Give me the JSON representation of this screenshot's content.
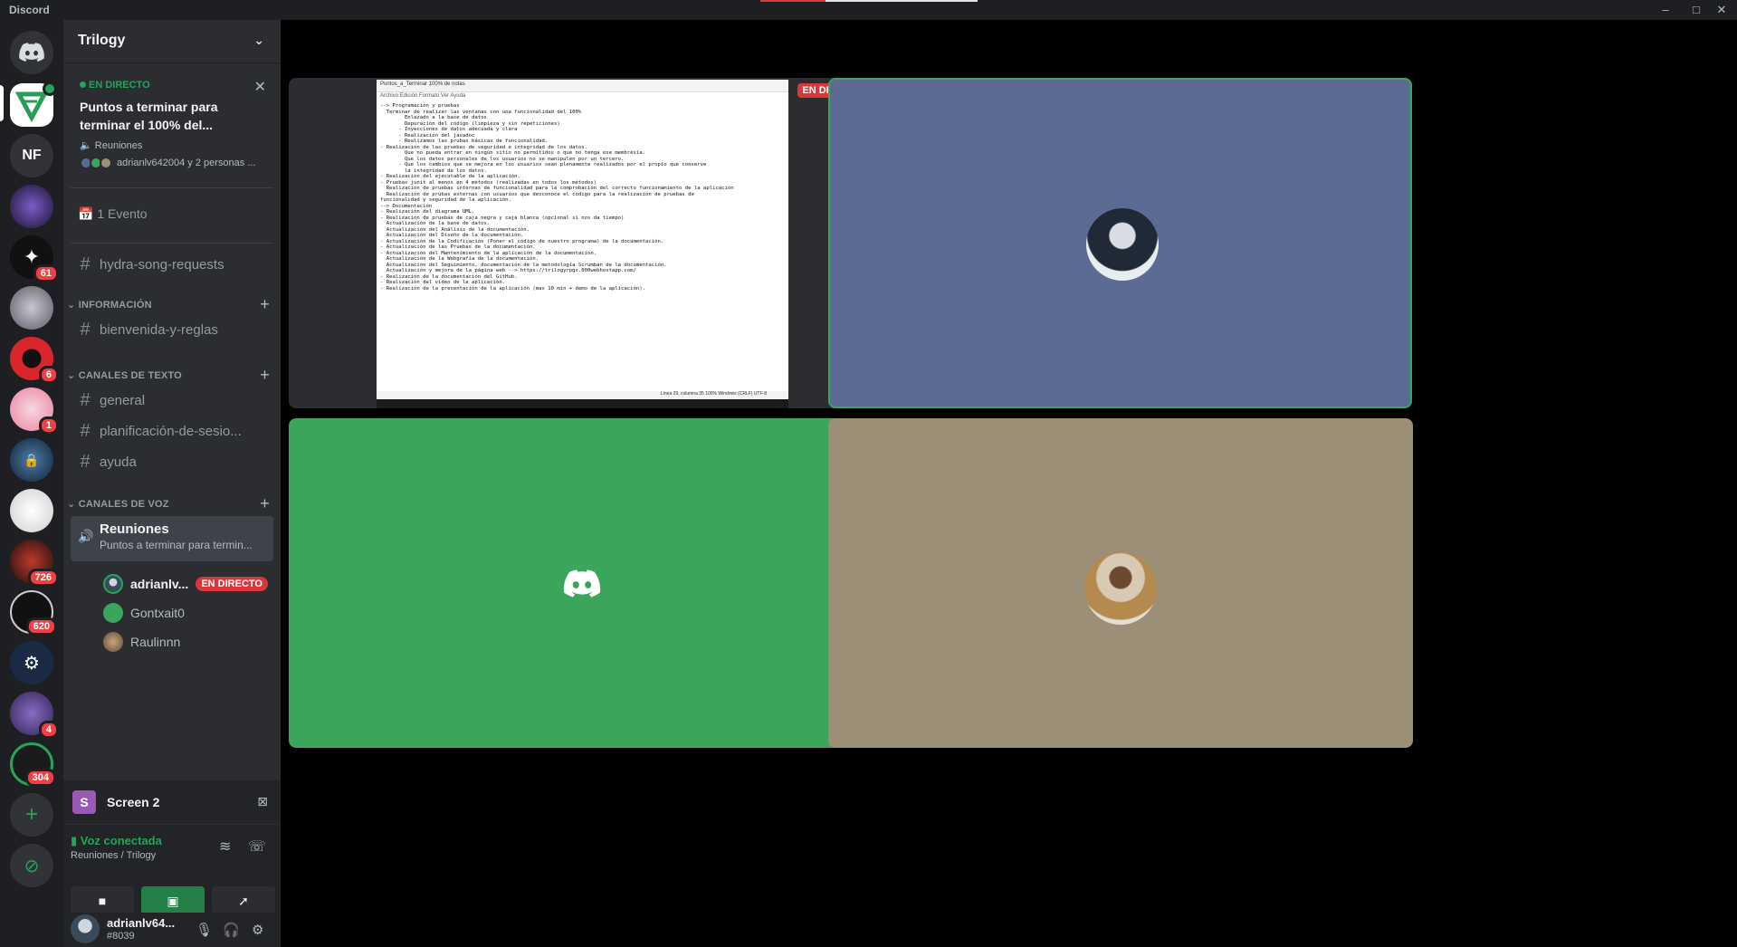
{
  "window": {
    "app_name": "Discord",
    "progress": 0.3,
    "controls": [
      "–",
      "□",
      "✕"
    ]
  },
  "rail": {
    "servers": [
      {
        "name": "Home",
        "label": ""
      },
      {
        "name": "Trilogy",
        "label": ""
      },
      {
        "name": "NF",
        "label": "NF"
      },
      {
        "name": "server-4",
        "label": ""
      },
      {
        "name": "server-5",
        "label": "",
        "badge": "61"
      },
      {
        "name": "server-6",
        "label": ""
      },
      {
        "name": "server-7",
        "label": "",
        "badge": "6"
      },
      {
        "name": "server-8",
        "label": "",
        "badge": "1"
      },
      {
        "name": "server-9",
        "label": ""
      },
      {
        "name": "server-10",
        "label": ""
      },
      {
        "name": "server-11",
        "label": "",
        "badge": "726"
      },
      {
        "name": "server-12",
        "label": "",
        "badge": "620"
      },
      {
        "name": "server-13",
        "label": ""
      },
      {
        "name": "server-14",
        "label": "",
        "badge": "4"
      },
      {
        "name": "server-15",
        "label": "",
        "badge": "304"
      }
    ],
    "add_label": "+",
    "explore_label": "⊘"
  },
  "sidebar": {
    "guild_name": "Trilogy",
    "event": {
      "live_label": "EN DIRECTO",
      "title": "Puntos a terminar para terminar el 100% del...",
      "channel": "Reuniones",
      "users": "adrianlv642004 y 2 personas ..."
    },
    "events_count": "1 Evento",
    "channels_top": [
      {
        "name": "hydra-song-requests"
      }
    ],
    "categories": {
      "info": "INFORMACIÓN",
      "text": "CANALES DE TEXTO",
      "voice": "CANALES DE VOZ"
    },
    "info_channels": [
      {
        "name": "bienvenida-y-reglas"
      }
    ],
    "text_channels": [
      {
        "name": "general"
      },
      {
        "name": "planificación-de-sesio..."
      },
      {
        "name": "ayuda"
      }
    ],
    "voice_channel": {
      "name": "Reuniones",
      "subtitle": "Puntos a terminar para termin...",
      "users": [
        {
          "name": "adrianlv...",
          "live": "EN DIRECTO"
        },
        {
          "name": "Gontxait0"
        },
        {
          "name": "Raulinnn"
        }
      ]
    },
    "screen_panel": {
      "icon_letter": "S",
      "label": "Screen 2"
    },
    "voice_panel": {
      "status": "Voz conectada",
      "location": "Reuniones / Trilogy"
    },
    "user_panel": {
      "name": "adrianlv64...",
      "tag": "#8039"
    }
  },
  "stage": {
    "live_badge": "EN DIRECTO",
    "more_label": "•••",
    "document": {
      "title": "Puntos_a_Terminar 100% de notas",
      "menu": "Archivo   Edición   Formato   Ver   Ayuda",
      "lines": [
        "--> Programación y pruebas",
        "  Terminar de realizar las ventanas con una funcionalidad del 100%",
        "        Enlazado a la base de datos",
        "        Depuración del código (limpieza y sin repeticiones)",
        "      - Inyecciones de datos adecuada y clara",
        "      - Realización del javadoc",
        "      - Realizamos las prubas básicas de funcionalidad.",
        "- Realización de las pruebas de seguridad e integridad de los datos.",
        "        Que no pueda entrar en ningún sitio no permitidos o que no tenga ese membresía.",
        "        Que los datos personales de los usuarios no se manipulen por un tercero.",
        "      - Que los cambios que se mejora en los usuarios sean plenamente realizados por el propio que conserve",
        "        la integridad de los datos.",
        "- Realización del ejecutable de la aplicación.",
        "- Pruebas junit al menos en 4 métodos (realizadas en todos los métodos)",
        "  Realización de pruebas internas de funcionalidad para la comprobación del correcto funcionamiento de la aplicación",
        "  Realización de prubas externas con usuarios que desconoce el código para la realización de pruebas de",
        "funcionalidad y seguridad de la aplicación.",
        "--> Documentación",
        "- Realización del diagrama UML.",
        "- Realización de pruebas de caja negra y caja blanca (opcional si nos da tiempo)",
        "  Actualización de la base de datos.",
        "  Actualización del Análisis de la documentación.",
        "  Actualización del Diseño de la documentación.",
        "- Actualización de la Codificación (Poner el código de nuestro programa) de la documentación.",
        "- Actualización de las Pruebas de la documentación.",
        "- Actualización del Mantenimiento de la aplicación de la documentación.",
        "  Actualización de la Webgrafía de la documentación.",
        "  Actualización del Seguimiento, documentación de la metodología Scrumban de la documentación.",
        "  Actualización y mejora de la página web --> https://trilogyrpgs.000webhostapp.com/",
        "- Realización de la documentación del GitHub.",
        "- Realización del vídeo de la aplicación.",
        "- Realización de la presentación de la aplicación (max 10 min + demo de la aplicación)."
      ],
      "status": "Línea 29, columna 35     100%     Windows (CRLF)     UTF-8"
    }
  },
  "colors": {
    "tile_blue": "#5b6b94",
    "tile_green": "#3ba55c",
    "tile_tan": "#9c8f78",
    "accent_green": "#23a55a",
    "live_red": "#da373c"
  }
}
